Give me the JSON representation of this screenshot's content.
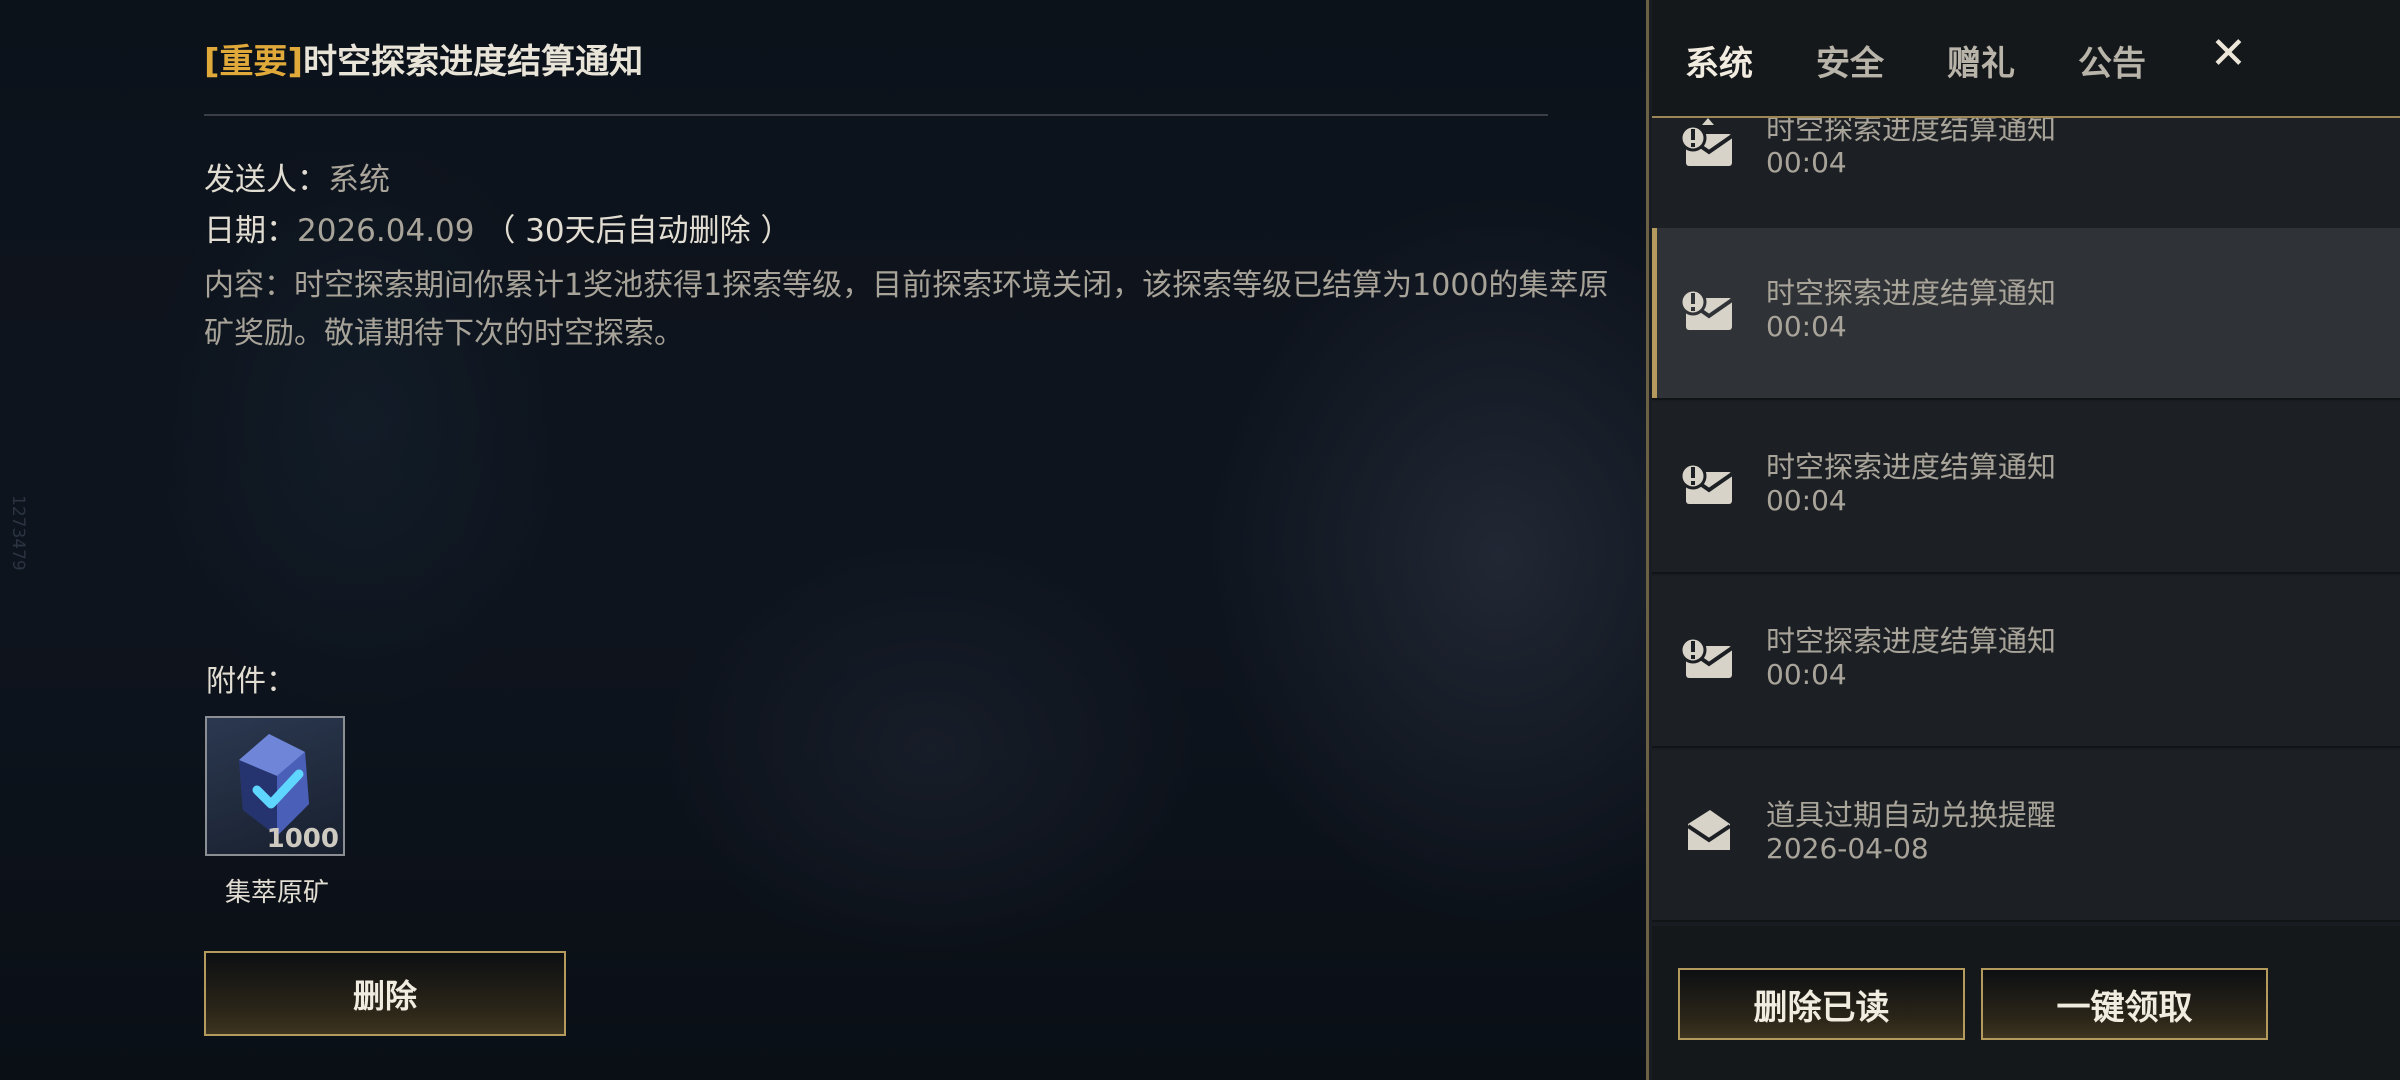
{
  "background": {
    "side_label": "1273479"
  },
  "detail": {
    "title_tag": "[重要]",
    "title": "时空探索进度结算通知",
    "sender_label": "发送人：",
    "sender": "系统",
    "date_label": "日期：",
    "date": "2026.04.09",
    "auto_delete": "（ 30天后自动删除 ）",
    "content": "内容：时空探索期间你累计1奖池获得1探索等级，目前探索环境关闭，该探索等级已结算为1000的集萃原矿奖励。敬请期待下次的时空探索。",
    "attachment_label": "附件：",
    "attachment": {
      "qty": "1000",
      "name": "集萃原矿"
    },
    "delete_label": "删除"
  },
  "tabs": [
    {
      "label": "系统",
      "active": true
    },
    {
      "label": "安全",
      "active": false
    },
    {
      "label": "赠礼",
      "active": false
    },
    {
      "label": "公告",
      "active": false
    }
  ],
  "close_label": "✕",
  "mails": [
    {
      "title": "时空探索进度结算通知",
      "time": "00:04",
      "icon": "important-mail-icon"
    },
    {
      "title": "时空探索进度结算通知",
      "time": "00:04",
      "icon": "important-mail-icon",
      "selected": true
    },
    {
      "title": "时空探索进度结算通知",
      "time": "00:04",
      "icon": "important-mail-icon"
    },
    {
      "title": "时空探索进度结算通知",
      "time": "00:04",
      "icon": "important-mail-icon"
    },
    {
      "title": "道具过期自动兑换提醒",
      "time": "2026-04-08",
      "icon": "read-mail-icon"
    }
  ],
  "footer": {
    "delete_read_label": "删除已读",
    "claim_all_label": "一键领取"
  },
  "colors": {
    "accent_gold": "#b59a5e",
    "tag_orange": "#e0a93a"
  }
}
